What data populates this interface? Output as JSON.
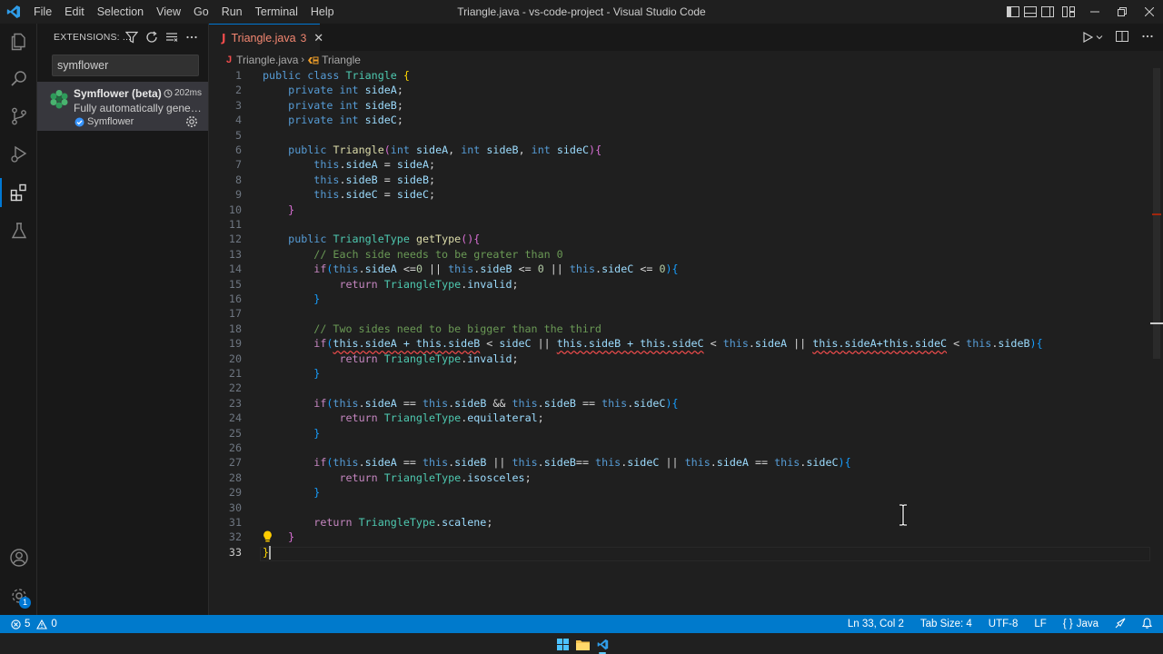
{
  "window": {
    "title": "Triangle.java - vs-code-project - Visual Studio Code",
    "menu": [
      "File",
      "Edit",
      "Selection",
      "View",
      "Go",
      "Run",
      "Terminal",
      "Help"
    ]
  },
  "sidebar": {
    "title": "EXTENSIONS: ...",
    "search_value": "symflower",
    "extension": {
      "name": "Symflower (beta)",
      "time": "202ms",
      "description": "Fully automatically genera...",
      "publisher": "Symflower"
    }
  },
  "activity": {
    "accounts_badge": "1"
  },
  "editor": {
    "tab": {
      "name": "Triangle.java",
      "problems": "3"
    },
    "breadcrumb": {
      "file": "Triangle.java",
      "symbol": "Triangle"
    },
    "line_numbers": [
      "1",
      "2",
      "3",
      "4",
      "5",
      "6",
      "7",
      "8",
      "9",
      "10",
      "11",
      "12",
      "13",
      "14",
      "15",
      "16",
      "17",
      "18",
      "19",
      "20",
      "21",
      "22",
      "23",
      "24",
      "25",
      "26",
      "27",
      "28",
      "29",
      "30",
      "31",
      "32",
      "33"
    ],
    "lines": {
      "l1": [
        "public",
        " ",
        "class",
        " ",
        "Triangle",
        " ",
        "{"
      ],
      "l2": [
        "private",
        "int",
        "sideA",
        ";"
      ],
      "l3": [
        "private",
        "int",
        "sideB",
        ";"
      ],
      "l4": [
        "private",
        "int",
        "sideC",
        ";"
      ],
      "l6": [
        "public",
        "Triangle",
        "(",
        "int",
        "sideA",
        ", ",
        "int",
        "sideB",
        ", ",
        "int",
        "sideC",
        ")",
        "{"
      ],
      "l7": [
        "this",
        ".",
        "sideA",
        " = ",
        "sideA",
        ";"
      ],
      "l8": [
        "this",
        ".",
        "sideB",
        " = ",
        "sideB",
        ";"
      ],
      "l9": [
        "this",
        ".",
        "sideC",
        " = ",
        "sideC",
        ";"
      ],
      "l10": "}",
      "l12": [
        "public",
        "TriangleType",
        "getType",
        "()",
        "{"
      ],
      "l13": "// Each side needs to be greater than 0",
      "l14": [
        "if",
        "(",
        "this",
        ".",
        "sideA",
        " <=",
        "0",
        " || ",
        "this",
        ".",
        "sideB",
        " <= ",
        "0",
        " || ",
        "this",
        ".",
        "sideC",
        " <= ",
        "0",
        ")",
        "{"
      ],
      "l15": [
        "return",
        "TriangleType",
        ".",
        "invalid",
        ";"
      ],
      "l16": "}",
      "l18": "// Two sides need to be bigger than the third",
      "l19": {
        "kw_if": "if",
        "p1": "(",
        "e1": "this.sideA + this.sideB",
        "op1": " < ",
        "v1": "sideC",
        "or1": " || ",
        "e2": "this.sideB + this.sideC",
        "op2": " < ",
        "t2": "this",
        "d2": ".",
        "v2": "sideA",
        "or2": " || ",
        "e3": "this.sideA+this.sideC",
        "op3": " < ",
        "t3": "this",
        "d3": ".",
        "v3": "sideB",
        "p2": ")",
        "b": "{"
      },
      "l20": [
        "return",
        "TriangleType",
        ".",
        "invalid",
        ";"
      ],
      "l21": "}",
      "l23": [
        "if",
        "(",
        "this",
        ".",
        "sideA",
        " == ",
        "this",
        ".",
        "sideB",
        " && ",
        "this",
        ".",
        "sideB",
        " == ",
        "this",
        ".",
        "sideC",
        ")",
        "{"
      ],
      "l24": [
        "return",
        "TriangleType",
        ".",
        "equilateral",
        ";"
      ],
      "l25": "}",
      "l27": [
        "if",
        "(",
        "this",
        ".",
        "sideA",
        " == ",
        "this",
        ".",
        "sideB",
        " || ",
        "this",
        ".",
        "sideB",
        "== ",
        "this",
        ".",
        "sideC",
        " || ",
        "this",
        ".",
        "sideA",
        " == ",
        "this",
        ".",
        "sideC",
        ")",
        "{"
      ],
      "l28": [
        "return",
        "TriangleType",
        ".",
        "isosceles",
        ";"
      ],
      "l29": "}",
      "l31": [
        "return",
        "TriangleType",
        ".",
        "scalene",
        ";"
      ],
      "l32": "}",
      "l33": "}"
    }
  },
  "status": {
    "errors": "5",
    "warnings": "0",
    "position": "Ln 33, Col 2",
    "tab_size": "Tab Size: 4",
    "encoding": "UTF-8",
    "eol": "LF",
    "language": "Java"
  },
  "colors": {
    "accent": "#0078d4",
    "statusbar": "#007acc",
    "error": "#f14c4c"
  }
}
